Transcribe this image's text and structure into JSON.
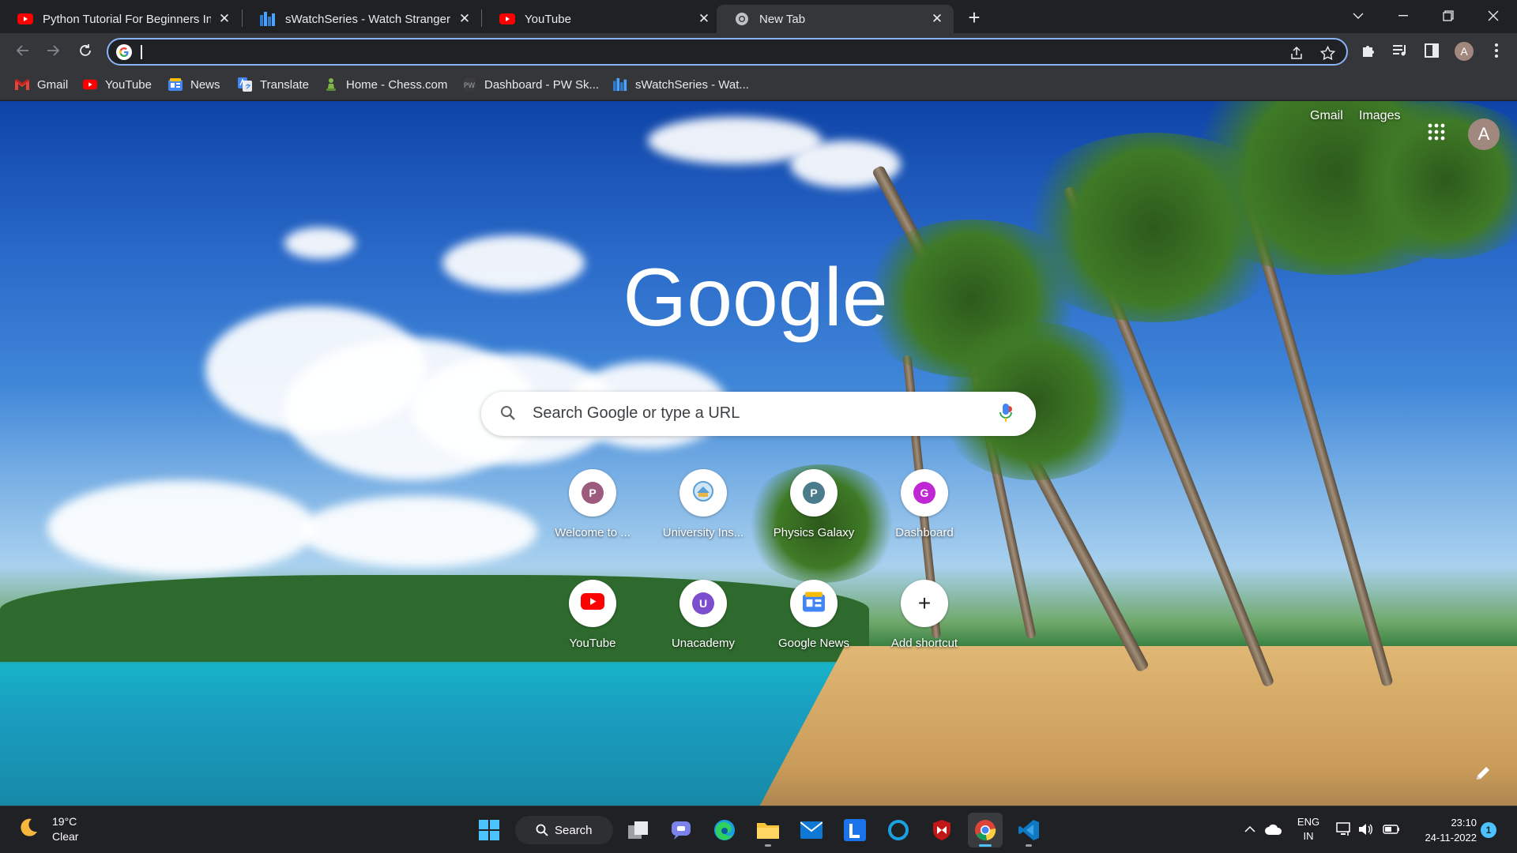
{
  "tabs": [
    {
      "title": "Python Tutorial For Beginners In",
      "icon": "youtube-icon"
    },
    {
      "title": "sWatchSeries - Watch Stranger Th",
      "icon": "swatchseries-icon"
    },
    {
      "title": "YouTube",
      "icon": "youtube-icon"
    },
    {
      "title": "New Tab",
      "icon": "chrome-icon",
      "active": true
    }
  ],
  "new_tab_label": "+",
  "omnibox": {
    "value": ""
  },
  "profile_initial": "A",
  "bookmarks": [
    {
      "label": "Gmail",
      "icon": "gmail-icon"
    },
    {
      "label": "YouTube",
      "icon": "youtube-icon"
    },
    {
      "label": "News",
      "icon": "google-news-icon"
    },
    {
      "label": "Translate",
      "icon": "google-translate-icon"
    },
    {
      "label": "Home - Chess.com",
      "icon": "chess-icon"
    },
    {
      "label": "Dashboard - PW Sk...",
      "icon": "pw-skills-icon"
    },
    {
      "label": "sWatchSeries - Wat...",
      "icon": "swatchseries-icon"
    }
  ],
  "ntp": {
    "links": {
      "gmail": "Gmail",
      "images": "Images"
    },
    "account_initial": "A",
    "logo_text": "Google",
    "search_placeholder": "Search Google or type a URL",
    "shortcuts": [
      {
        "label": "Welcome to ...",
        "letter": "P",
        "color": "#9c5a7c"
      },
      {
        "label": "University Ins...",
        "letter": "",
        "color": "#5aa0d8"
      },
      {
        "label": "Physics Galaxy",
        "letter": "P",
        "color": "#4a7c8c"
      },
      {
        "label": "Dashboard",
        "letter": "G",
        "color": "#c026d3"
      },
      {
        "label": "YouTube",
        "letter": "",
        "color": "#ff0000"
      },
      {
        "label": "Unacademy",
        "letter": "U",
        "color": "#7c4dcc"
      },
      {
        "label": "Google News",
        "letter": "",
        "color": "#4285f4"
      },
      {
        "label": "Add shortcut",
        "letter": "+",
        "color": "#202124"
      }
    ]
  },
  "taskbar": {
    "weather": {
      "temp": "19°C",
      "condition": "Clear"
    },
    "search_label": "Search",
    "language": {
      "line1": "ENG",
      "line2": "IN"
    },
    "clock": {
      "time": "23:10",
      "date": "24-11-2022"
    },
    "notifications": "1"
  },
  "colors": {
    "accent": "#8ab4f8",
    "tab_bg": "#202124",
    "toolbar_bg": "#35363a"
  }
}
